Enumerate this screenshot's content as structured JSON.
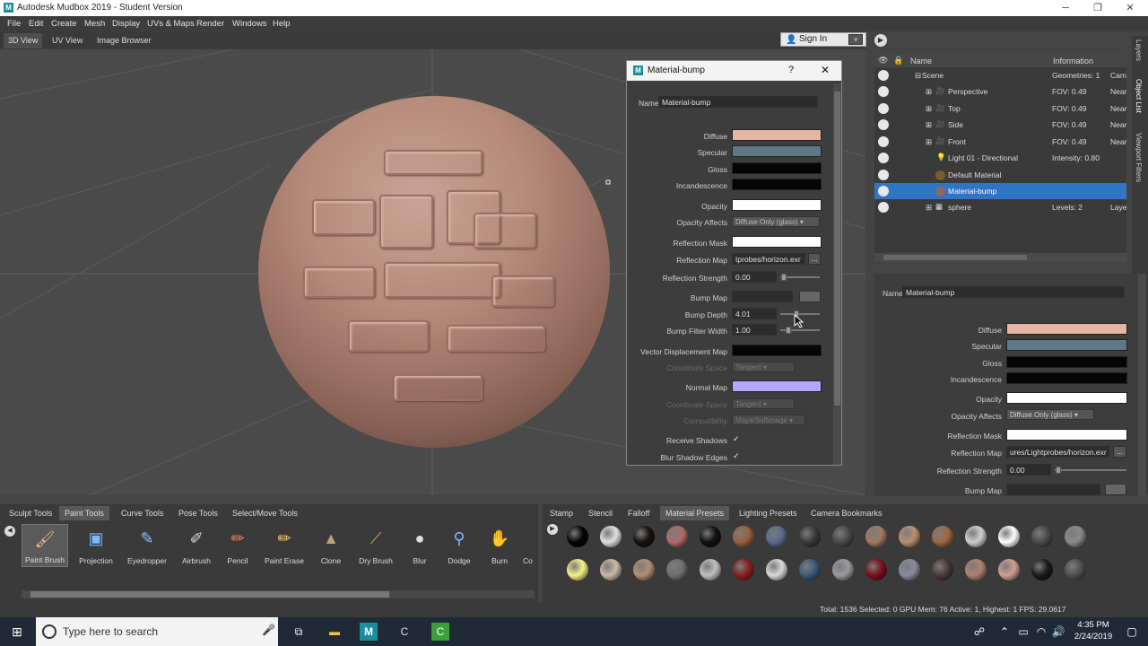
{
  "window": {
    "title": "Autodesk Mudbox 2019 - Student Version",
    "logo": "M"
  },
  "menu": [
    "File",
    "Edit",
    "Create",
    "Mesh",
    "Display",
    "UVs & Maps",
    "Render",
    "Windows",
    "Help"
  ],
  "view_tabs": [
    "3D View",
    "UV View",
    "Image Browser"
  ],
  "signin": {
    "label": "Sign In"
  },
  "dialog": {
    "logo": "M",
    "title": "Material-bump",
    "help": "?",
    "close": "✕",
    "name_label": "Name",
    "name_value": "Material-bump",
    "rows": {
      "diffuse": "Diffuse",
      "specular": "Specular",
      "gloss": "Gloss",
      "incandescence": "Incandescence",
      "opacity": "Opacity",
      "opacity_affects": "Opacity Affects",
      "opacity_affects_value": "Diffuse Only (glass)",
      "reflection_mask": "Reflection Mask",
      "reflection_map": "Reflection Map",
      "reflection_map_value": "tprobes/horizon.exr",
      "reflection_strength": "Reflection Strength",
      "reflection_strength_value": "0.00",
      "bump_map": "Bump Map",
      "bump_depth": "Bump Depth",
      "bump_depth_value": "4.01",
      "bump_filter_width": "Bump Filter Width",
      "bump_filter_width_value": "1.00",
      "vector_displacement_map": "Vector Displacement Map",
      "coordinate_space": "Coordinate Space",
      "coordinate_space_value": "Tangent",
      "normal_map": "Normal Map",
      "coordinate_space2": "Coordinate Space",
      "coordinate_space2_value": "Tangent",
      "compatibility": "Compatibility",
      "compatibility_value": "Maya/Softimage",
      "receive_shadows": "Receive Shadows",
      "blur_shadow_edges": "Blur Shadow Edges",
      "browse": "..."
    },
    "colors": {
      "diffuse": "#e6b6a4",
      "specular": "#5f7888",
      "gloss": "#050505",
      "incandescence": "#050505",
      "opacity": "#ffffff",
      "reflection_mask": "#ffffff",
      "normal_map": "#b3a6ff"
    }
  },
  "outliner": {
    "headers": {
      "name": "Name",
      "info": "Information"
    },
    "rows": [
      {
        "name": "Scene",
        "info": "Geometries: 1",
        "extra": "Cam"
      },
      {
        "name": "Perspective",
        "info": "FOV: 0.49",
        "extra": "Near"
      },
      {
        "name": "Top",
        "info": "FOV: 0.49",
        "extra": "Near"
      },
      {
        "name": "Side",
        "info": "FOV: 0.49",
        "extra": "Near"
      },
      {
        "name": "Front",
        "info": "FOV: 0.49",
        "extra": "Near"
      },
      {
        "name": "Light 01 - Directional",
        "info": "Intensity: 0.80",
        "extra": ""
      },
      {
        "name": "Default Material",
        "info": "",
        "extra": ""
      },
      {
        "name": "Material-bump",
        "info": "",
        "extra": ""
      },
      {
        "name": "sphere",
        "info": "Levels: 2",
        "extra": "Laye"
      }
    ]
  },
  "side_tabs": [
    "Layers",
    "Object List",
    "Viewport Filters"
  ],
  "props": {
    "name_label": "Name",
    "name_value": "Material-bump",
    "diffuse": "Diffuse",
    "specular": "Specular",
    "gloss": "Gloss",
    "incandescence": "Incandescence",
    "opacity": "Opacity",
    "opacity_affects": "Opacity Affects",
    "opacity_affects_value": "Diffuse Only (glass)",
    "reflection_mask": "Reflection Mask",
    "reflection_map": "Reflection Map",
    "reflection_map_value": "ures/Lightprobes/horizon.exr",
    "reflection_strength": "Reflection Strength",
    "reflection_strength_value": "0.00",
    "bump_map": "Bump Map",
    "browse": "..."
  },
  "shelf_left": {
    "tabs": [
      "Sculpt Tools",
      "Paint Tools",
      "Curve Tools",
      "Pose Tools",
      "Select/Move Tools"
    ],
    "tools": [
      {
        "label": "Paint Brush",
        "icon": "🖌"
      },
      {
        "label": "Projection",
        "icon": "▣"
      },
      {
        "label": "Eyedropper",
        "icon": "✎"
      },
      {
        "label": "Airbrush",
        "icon": "✐"
      },
      {
        "label": "Pencil",
        "icon": "✏"
      },
      {
        "label": "Paint Erase",
        "icon": "✏"
      },
      {
        "label": "Clone",
        "icon": "▲"
      },
      {
        "label": "Dry Brush",
        "icon": "⟋"
      },
      {
        "label": "Blur",
        "icon": "●"
      },
      {
        "label": "Dodge",
        "icon": "⚲"
      },
      {
        "label": "Burn",
        "icon": "✋"
      },
      {
        "label": "Co",
        "icon": ""
      }
    ]
  },
  "shelf_right": {
    "tabs": [
      "Stamp",
      "Stencil",
      "Falloff",
      "Material Presets",
      "Lighting Presets",
      "Camera Bookmarks"
    ],
    "balls_row1": [
      "#050505",
      "#e0e0e0",
      "#1a1010",
      "#b06a6a",
      "#101010",
      "#9a6040",
      "#5a6a8a",
      "#3a3a3a",
      "#4a4a4a",
      "#a07a60",
      "#b89070",
      "#a06840",
      "#cfcfcf",
      "#ffffff",
      "#4a4a4a",
      "#8a8a8a"
    ],
    "balls_row2": [
      "#f4f48a",
      "#c8b8a8",
      "#b09070",
      "#707070",
      "#c0c0c0",
      "#8a2020",
      "#d8d8d8",
      "#3a5a7a",
      "#9a9aa0",
      "#7a1020",
      "#8a8aa0",
      "#4a3a3a",
      "#b08070",
      "#d0a090",
      "#1a1a1a",
      "#505050"
    ]
  },
  "status": "Total: 1536  Selected: 0  GPU Mem: 76  Active: 1, Highest: 1  FPS: 29.0617",
  "taskbar": {
    "search_placeholder": "Type here to search",
    "time": "4:35 PM",
    "date": "2/24/2019"
  }
}
